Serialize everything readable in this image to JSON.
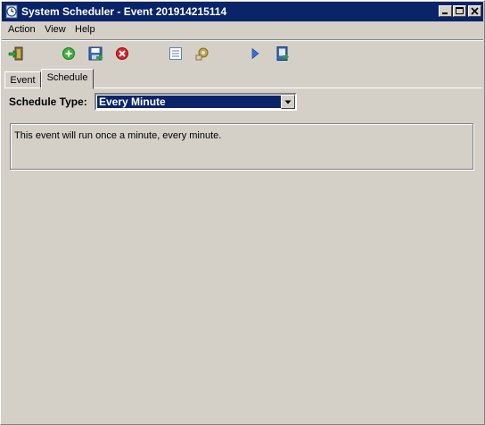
{
  "window": {
    "title": "System Scheduler - Event 201914215114"
  },
  "menu": {
    "items": [
      {
        "label": "Action"
      },
      {
        "label": "View"
      },
      {
        "label": "Help"
      }
    ]
  },
  "toolbar": {
    "buttons": [
      {
        "icon": "exit-door-icon"
      },
      {
        "icon": "add-icon"
      },
      {
        "icon": "save-icon"
      },
      {
        "icon": "delete-icon"
      },
      {
        "icon": "list-icon"
      },
      {
        "icon": "settings-icon"
      },
      {
        "icon": "run-icon"
      },
      {
        "icon": "export-icon"
      }
    ]
  },
  "tabs": [
    {
      "label": "Event",
      "active": false
    },
    {
      "label": "Schedule",
      "active": true
    }
  ],
  "schedule": {
    "type_label": "Schedule Type:",
    "type_value": "Every Minute",
    "description": "This event will run once a minute, every minute."
  },
  "colors": {
    "titlebar": "#0a246a",
    "face": "#d4d0c8",
    "selection": "#0a246a"
  }
}
